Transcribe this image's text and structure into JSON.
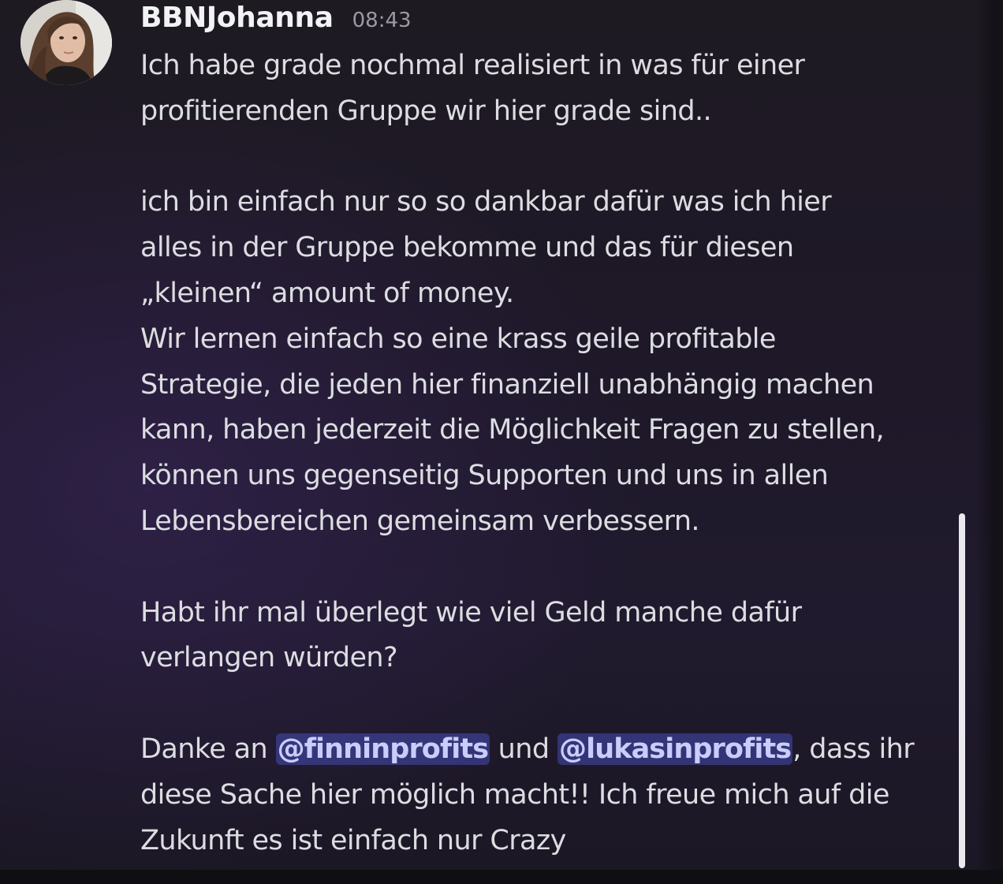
{
  "message": {
    "author": "BBNJohanna",
    "timestamp": "08:43",
    "lines": {
      "l1": "Ich habe grade nochmal realisiert in was für einer",
      "l2": "profitierenden Gruppe wir hier grade sind..",
      "l3": "ich bin einfach nur so so dankbar dafür was ich hier",
      "l4": "alles in der Gruppe bekomme und das für diesen",
      "l5": "„kleinen“ amount of money.",
      "l6": "Wir lernen einfach so eine krass geile profitable",
      "l7": "Strategie, die jeden hier finanziell unabhängig machen",
      "l8": "kann, haben jederzeit die Möglichkeit Fragen zu stellen,",
      "l9": "können uns gegenseitig Supporten und uns in allen",
      "l10": "Lebensbereichen gemeinsam verbessern.",
      "l11": "Habt ihr mal überlegt wie viel Geld manche dafür",
      "l12": "verlangen würden?",
      "l13_prefix": "Danke an ",
      "l13_mention1": "@finninprofits",
      "l13_middle": " und ",
      "l13_mention2": "@lukasinprofits",
      "l13_suffix": ", dass ihr",
      "l14": "diese Sache hier möglich macht!! Ich freue mich auf die",
      "l15": "Zukunft es ist einfach nur Crazy"
    }
  },
  "colors": {
    "background": "#1e1828",
    "text": "#dcdde1",
    "username": "#f2f3f5",
    "timestamp": "#9a9aa5",
    "mention_bg": "#5865f2",
    "mention_text": "#c9cdfb"
  }
}
